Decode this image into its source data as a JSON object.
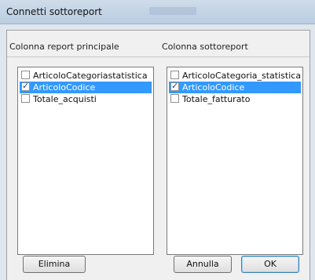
{
  "window": {
    "title": "Connetti sottoreport"
  },
  "left_panel": {
    "header": "Colonna report principale",
    "items": [
      {
        "label": "ArticoloCategoriastatistica",
        "checked": false,
        "selected": false
      },
      {
        "label": "ArticoloCodice",
        "checked": true,
        "selected": true
      },
      {
        "label": "Totale_acquisti",
        "checked": false,
        "selected": false
      }
    ]
  },
  "right_panel": {
    "header": "Colonna sottoreport",
    "items": [
      {
        "label": "ArticoloCategoria_statistica",
        "checked": false,
        "selected": false
      },
      {
        "label": "ArticoloCodice",
        "checked": true,
        "selected": true
      },
      {
        "label": "Totale_fatturato",
        "checked": false,
        "selected": false
      }
    ]
  },
  "buttons": {
    "delete_label": "Elimina",
    "cancel_label": "Annulla",
    "ok_label": "OK"
  },
  "colors": {
    "selection": "#3399ff",
    "window_frame": "#dfe6ee"
  }
}
